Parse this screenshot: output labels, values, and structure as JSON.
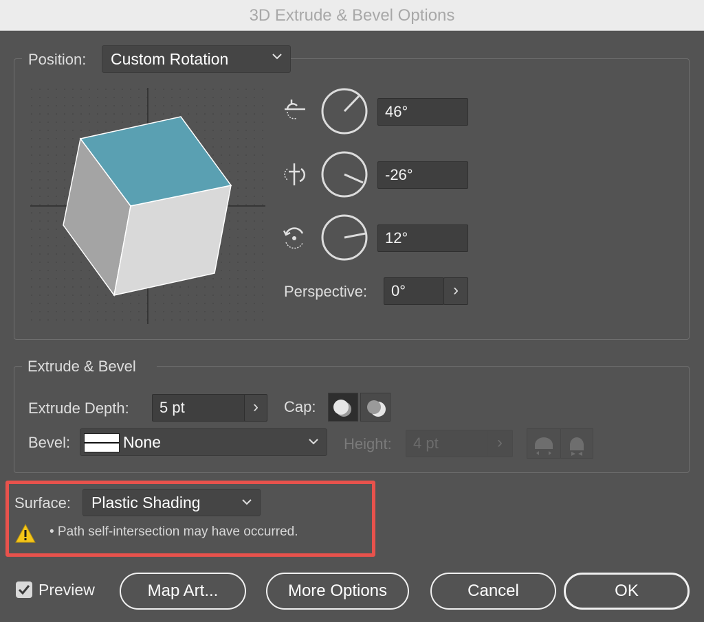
{
  "window": {
    "title": "3D Extrude & Bevel Options"
  },
  "position": {
    "label": "Position:",
    "preset": "Custom Rotation",
    "rotation_x": "46°",
    "rotation_y": "-26°",
    "rotation_z": "12°",
    "perspective_label": "Perspective:",
    "perspective_value": "0°",
    "stepper_glyph": "›"
  },
  "extrude_bevel": {
    "group_label": "Extrude & Bevel",
    "depth_label": "Extrude Depth:",
    "depth_value": "5 pt",
    "cap_label": "Cap:",
    "bevel_label": "Bevel:",
    "bevel_value": "None",
    "height_label": "Height:",
    "height_value": "4 pt"
  },
  "surface": {
    "label": "Surface:",
    "value": "Plastic Shading",
    "warning": "• Path self-intersection may have occurred."
  },
  "footer": {
    "preview_label": "Preview",
    "preview_checked": true,
    "map_art": "Map Art...",
    "more_options": "More Options",
    "cancel": "Cancel",
    "ok": "OK"
  },
  "colors": {
    "cube_top": "#5aa0b2",
    "cube_left": "#a4a4a4",
    "cube_right": "#d9d9d9",
    "highlight": "#e8524c",
    "warning": "#f5c518"
  }
}
